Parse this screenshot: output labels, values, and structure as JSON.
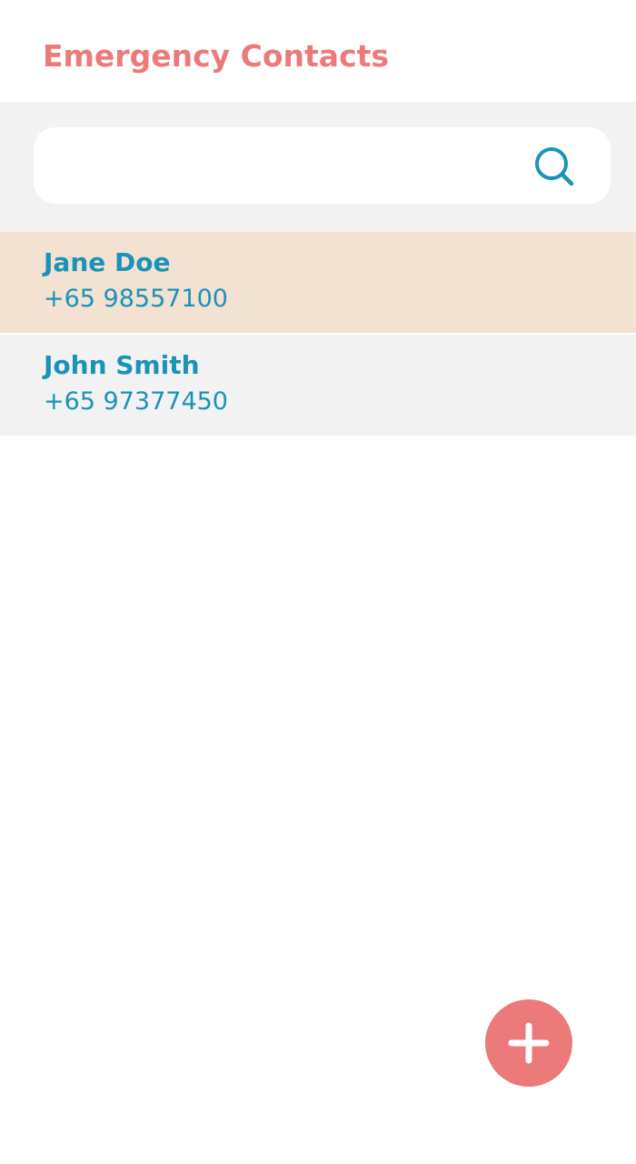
{
  "header": {
    "title": "Emergency Contacts"
  },
  "search": {
    "value": "",
    "placeholder": "",
    "icon": "search-icon"
  },
  "contacts": [
    {
      "name": "Jane Doe",
      "phone": "+65 98557100",
      "selected": true
    },
    {
      "name": "John Smith",
      "phone": "+65 97377450",
      "selected": false
    }
  ],
  "fab": {
    "icon": "plus-icon"
  },
  "colors": {
    "title": "#ec7a7a",
    "accent": "#1a93b8",
    "fab": "#ec7a7a",
    "selected_row": "#f3e1d1",
    "row": "#f2f2f2",
    "search_area": "#f2f2f2"
  }
}
